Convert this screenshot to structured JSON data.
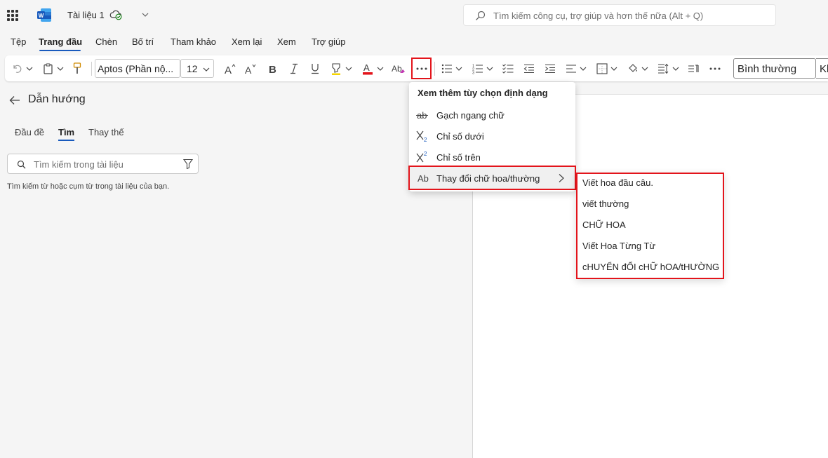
{
  "titlebar": {
    "doc_title": "Tài liệu 1",
    "search_placeholder": "Tìm kiếm công cụ, trợ giúp và hơn thế nữa (Alt + Q)"
  },
  "tabs": [
    "Tệp",
    "Trang đầu",
    "Chèn",
    "Bố trí",
    "Tham khảo",
    "Xem lại",
    "Xem",
    "Trợ giúp"
  ],
  "active_tab": "Trang đầu",
  "ribbon": {
    "font_name": "Aptos (Phần nộ...",
    "font_size": "12",
    "style_name": "Bình thường",
    "style_next": "Kh",
    "more_button_label": "···"
  },
  "nav": {
    "title": "Dẫn hướng",
    "tabs": [
      "Đầu đề",
      "Tìm",
      "Thay thế"
    ],
    "active_tab": "Tìm",
    "search_placeholder": "Tìm kiếm trong tài liệu",
    "hint": "Tìm kiếm từ hoặc cụm từ trong tài liệu của bạn."
  },
  "format_menu": {
    "heading": "Xem thêm tùy chọn định dạng",
    "items": [
      {
        "icon": "strikethrough-icon",
        "label": "Gạch ngang chữ"
      },
      {
        "icon": "subscript-icon",
        "label": "Chỉ số dưới"
      },
      {
        "icon": "superscript-icon",
        "label": "Chỉ số trên"
      },
      {
        "icon": "change-case-icon",
        "label": "Thay đổi chữ hoa/thường"
      }
    ]
  },
  "case_submenu": {
    "items": [
      "Viết hoa đầu câu.",
      "viết thường",
      "CHỮ HOA",
      "Viết Hoa Từng Từ",
      "cHUYỂN đỔI cHỮ hOA/tHƯỜNG"
    ]
  },
  "colors": {
    "accent": "#185abd",
    "highlight_border": "#e3141b",
    "font_color_bar": "#e3141b"
  }
}
